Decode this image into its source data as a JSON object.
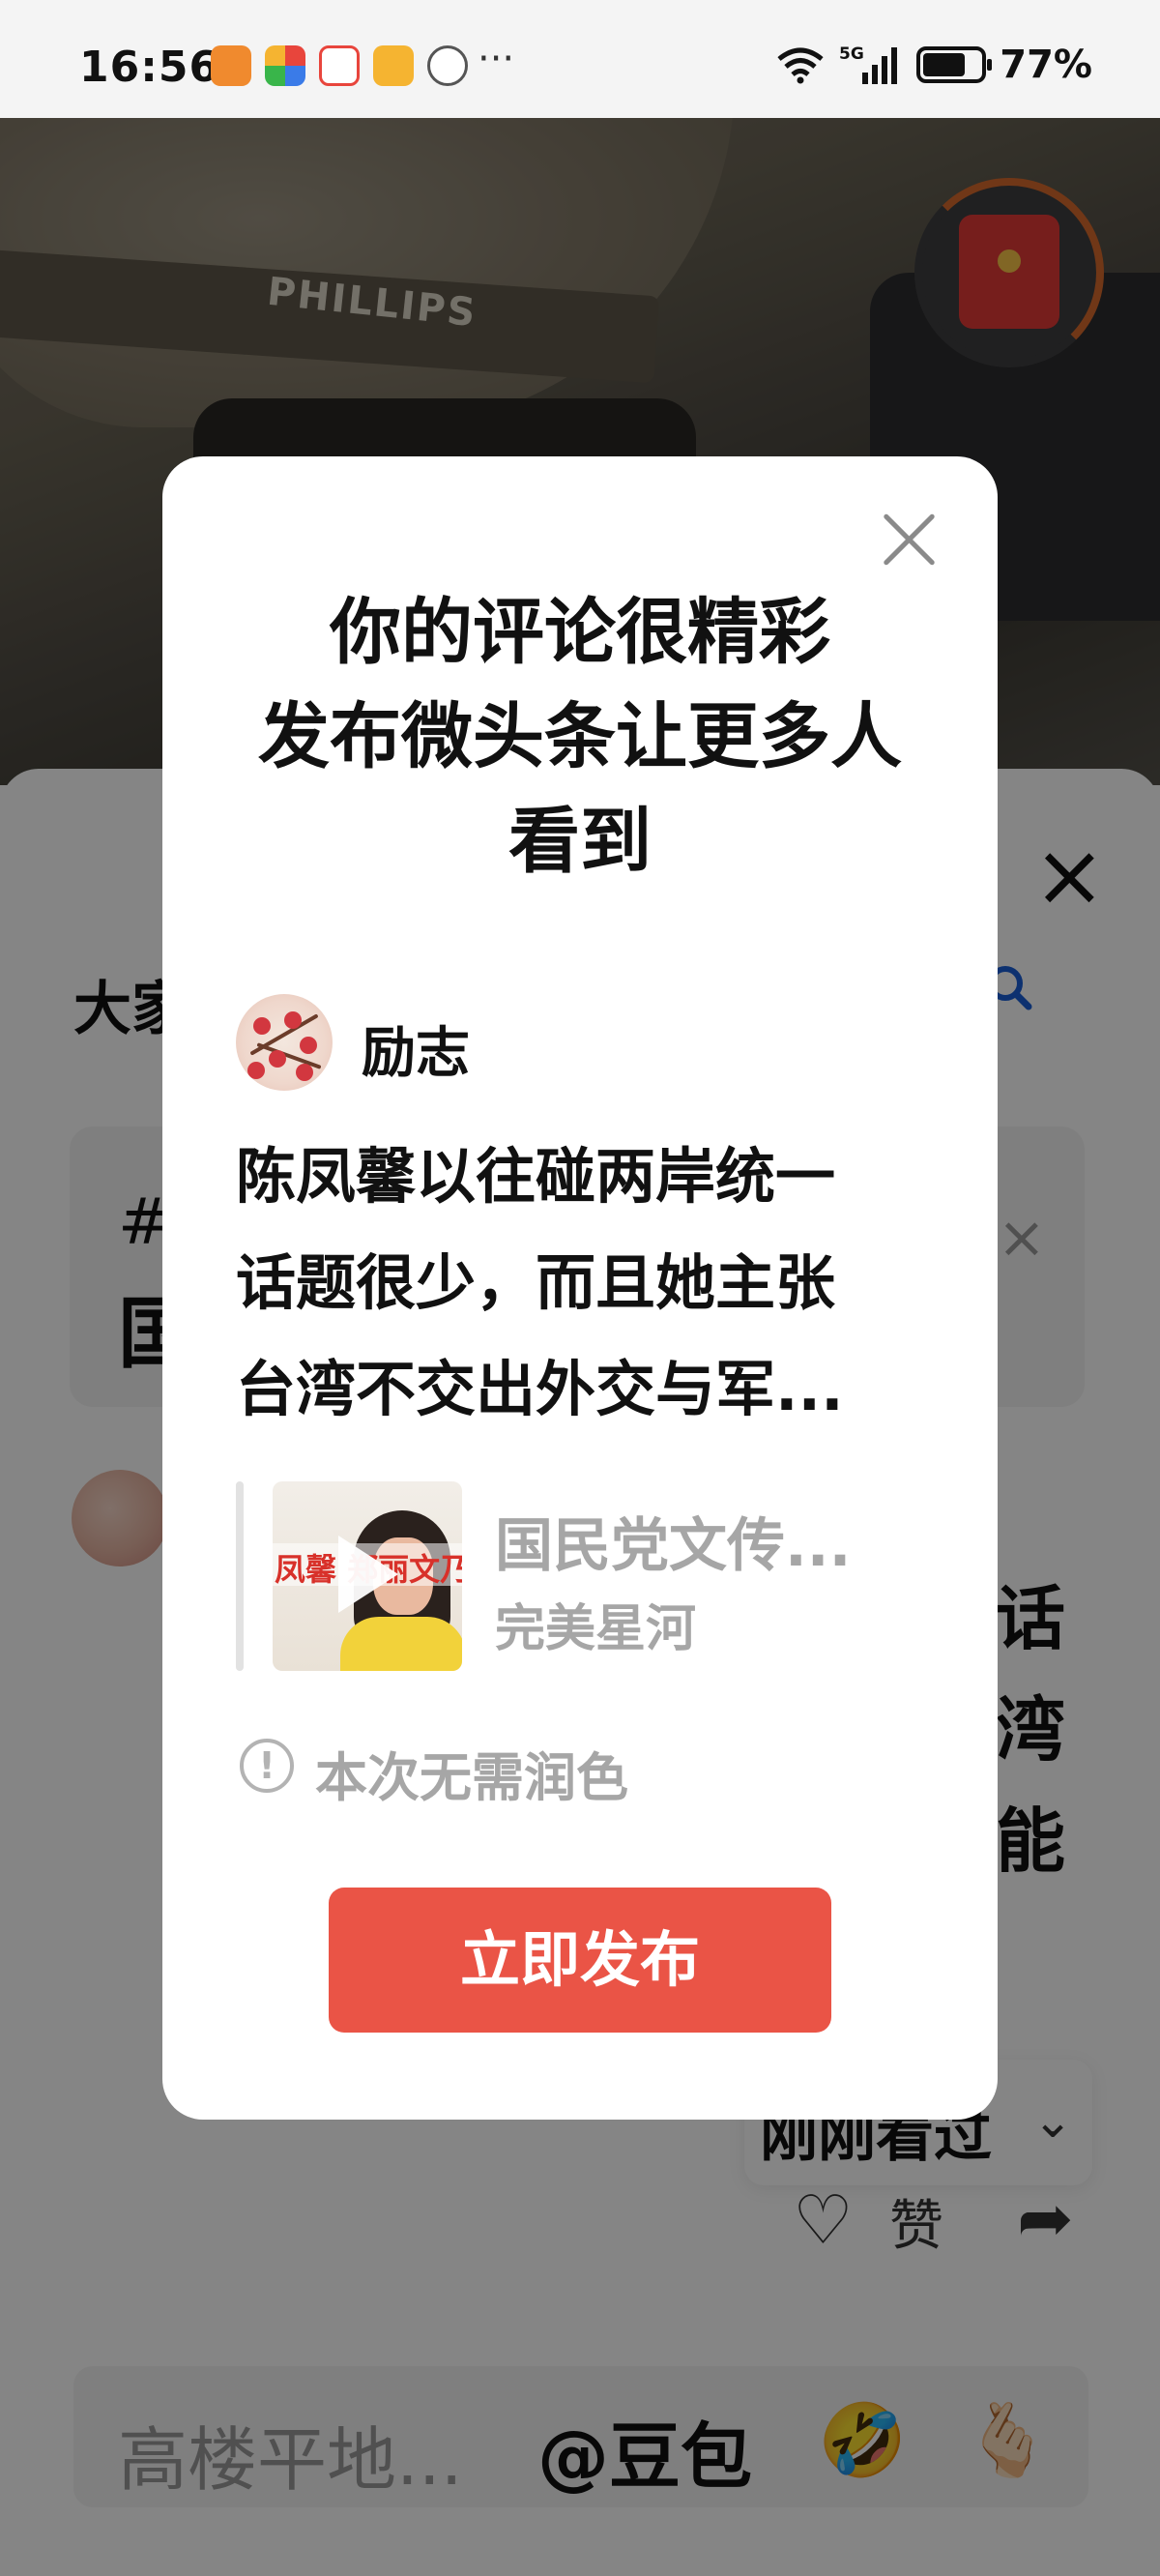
{
  "status_bar": {
    "time": "16:56",
    "overflow": "···",
    "network": "5G",
    "battery_level": 0.77,
    "battery_pct": "77%",
    "app_icons": [
      {
        "name": "heart-app-icon",
        "color": "#f08a2e"
      },
      {
        "name": "colorful-app-icon",
        "color": "#3a7be8"
      },
      {
        "name": "618-app-icon",
        "color": "#e8453c"
      },
      {
        "name": "bag-app-icon",
        "color": "#f5b431"
      },
      {
        "name": "hand-app-icon",
        "color": "#555555"
      }
    ]
  },
  "video": {
    "helmet_label": "PHILLIPS"
  },
  "comment_sheet": {
    "title_fragment": "大家",
    "topic_icon": "#",
    "topic_fragment": "国",
    "comment_fragments": [
      "话",
      "湾",
      "能"
    ],
    "recent_label": "刚刚看过",
    "like_label": "赞",
    "input_placeholder": "高楼平地...",
    "input_mention": "@豆包",
    "emoji_left": "🤣",
    "emoji_right": "🫰🏻"
  },
  "modal": {
    "title_lines": [
      "你的评论很精彩",
      "发布微头条让更多人",
      "看到"
    ],
    "author": "励志",
    "preview_lines": [
      "陈凤馨以往碰两岸统一",
      "话题很少，而且她主张",
      "台湾不交出外交与军..."
    ],
    "card_title": "国民党文传...",
    "card_source": "完美星河",
    "thumb_caption": "凤馨 郑丽文乃菁",
    "hint": "本次无需润色",
    "publish_label": "立即发布"
  },
  "colors": {
    "accent": "#ea5446",
    "search_blue": "#1a5fd6",
    "muted_text": "#a6a6a6"
  }
}
